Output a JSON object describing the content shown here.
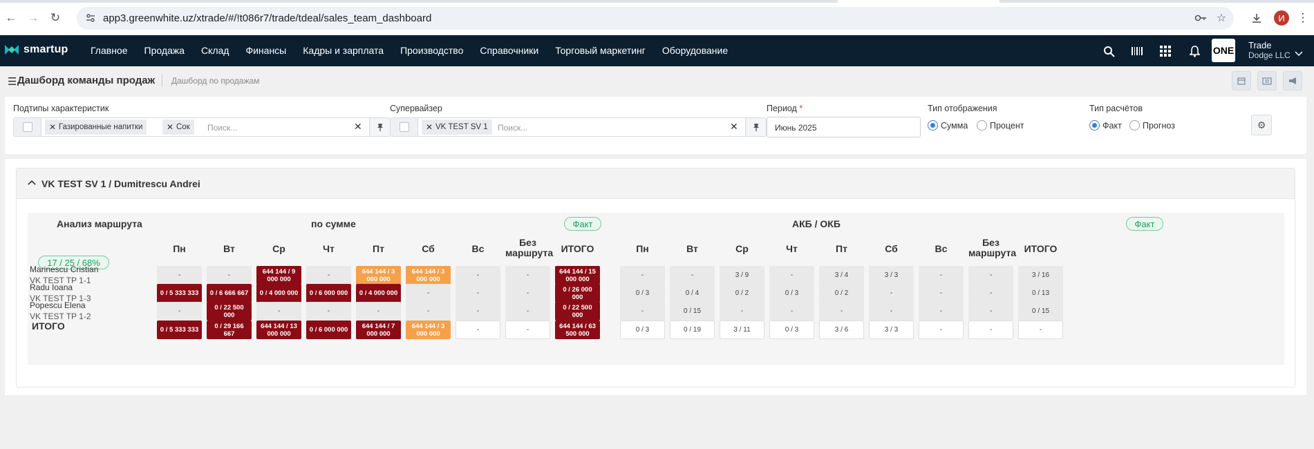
{
  "browser": {
    "url": "app3.greenwhite.uz/xtrade/#/!t086r7/trade/tdeal/sales_team_dashboard",
    "profile_initial": "И"
  },
  "app": {
    "logo_text": "smartup",
    "menu": [
      "Главное",
      "Продажа",
      "Склад",
      "Финансы",
      "Кадры и зарплата",
      "Производство",
      "Справочники",
      "Торговый маркетинг",
      "Оборудование"
    ],
    "brand_badge": "ONE",
    "company_line1": "Trade",
    "company_line2": "Dodge LLC"
  },
  "page": {
    "title": "Дашборд команды продаж",
    "breadcrumb": "Дашборд по продажам"
  },
  "filters": {
    "subtypes_label": "Подтипы характеристик",
    "subtypes_tags": [
      "Газированные напитки",
      "Сок"
    ],
    "search_placeholder": "Поиск...",
    "supervisor_label": "Супервайзер",
    "supervisor_tags": [
      "VK TEST SV 1"
    ],
    "period_label": "Период",
    "period_required_mark": "*",
    "period_value": "Июнь 2025",
    "display_type_label": "Тип отображения",
    "display_options": [
      "Сумма",
      "Процент"
    ],
    "display_selected": "Сумма",
    "calc_type_label": "Тип расчётов",
    "calc_options": [
      "Факт",
      "Прогноз"
    ],
    "calc_selected": "Факт"
  },
  "dashboard": {
    "group_title": "VK TEST SV 1 / Dumitrescu Andrei",
    "route_analysis_label": "Анализ маршрута",
    "by_sum_label": "по сумме",
    "fact_badge": "Факт",
    "akb_label": "АКБ / ОКБ",
    "summary_badge": "17 / 25 / 68%",
    "day_headers": [
      "Пн",
      "Вт",
      "Ср",
      "Чт",
      "Пт",
      "Сб",
      "Вс"
    ],
    "no_route_header": [
      "Без",
      "маршрута"
    ],
    "total_header": "ИТОГО",
    "total_row_label": "ИТОГО",
    "rows": [
      {
        "name": "Marinescu Cristian",
        "sub": "VK TEST TP 1-1",
        "sum": [
          {
            "v": "-",
            "c": "grey"
          },
          {
            "v": "-",
            "c": "grey"
          },
          {
            "v": "644 144 / 9 000 000",
            "c": "red"
          },
          {
            "v": "-",
            "c": "grey"
          },
          {
            "v": "644 144 / 3 000 000",
            "c": "orange"
          },
          {
            "v": "644 144 / 3 000 000",
            "c": "orange"
          },
          {
            "v": "-",
            "c": "grey"
          },
          {
            "v": "-",
            "c": "grey"
          },
          {
            "v": "644 144 / 15 000 000",
            "c": "red"
          }
        ],
        "akb": [
          "-",
          "-",
          "3 / 9",
          "-",
          "3 / 4",
          "3 / 3",
          "-",
          "-",
          "3 / 16"
        ]
      },
      {
        "name": "Radu Ioana",
        "sub": "VK TEST TP 1-3",
        "sum": [
          {
            "v": "0 / 5 333 333",
            "c": "red"
          },
          {
            "v": "0 / 6 666 667",
            "c": "red"
          },
          {
            "v": "0 / 4 000 000",
            "c": "red"
          },
          {
            "v": "0 / 6 000 000",
            "c": "red"
          },
          {
            "v": "0 / 4 000 000",
            "c": "red"
          },
          {
            "v": "-",
            "c": "grey"
          },
          {
            "v": "-",
            "c": "grey"
          },
          {
            "v": "-",
            "c": "grey"
          },
          {
            "v": "0 / 26 000 000",
            "c": "red"
          }
        ],
        "akb": [
          "0 / 3",
          "0 / 4",
          "0 / 2",
          "0 / 3",
          "0 / 2",
          "-",
          "-",
          "-",
          "0 / 13"
        ]
      },
      {
        "name": "Popescu Elena",
        "sub": "VK TEST TP 1-2",
        "sum": [
          {
            "v": "-",
            "c": "grey"
          },
          {
            "v": "0 / 22 500 000",
            "c": "red"
          },
          {
            "v": "-",
            "c": "grey"
          },
          {
            "v": "-",
            "c": "grey"
          },
          {
            "v": "-",
            "c": "grey"
          },
          {
            "v": "-",
            "c": "grey"
          },
          {
            "v": "-",
            "c": "grey"
          },
          {
            "v": "-",
            "c": "grey"
          },
          {
            "v": "0 / 22 500 000",
            "c": "red"
          }
        ],
        "akb": [
          "-",
          "0 / 15",
          "-",
          "-",
          "-",
          "-",
          "-",
          "-",
          "0 / 15"
        ]
      }
    ],
    "totals": {
      "sum": [
        {
          "v": "0 / 5 333 333",
          "c": "red"
        },
        {
          "v": "0 / 29 166 667",
          "c": "red"
        },
        {
          "v": "644 144 / 13 000 000",
          "c": "red"
        },
        {
          "v": "0 / 6 000 000",
          "c": "red"
        },
        {
          "v": "644 144 / 7 000 000",
          "c": "red"
        },
        {
          "v": "644 144 / 3 000 000",
          "c": "orange"
        },
        {
          "v": "-",
          "c": "white"
        },
        {
          "v": "-",
          "c": "white"
        },
        {
          "v": "644 144 / 63 500 000",
          "c": "red"
        }
      ],
      "akb": [
        "0 / 3",
        "0 / 19",
        "3 / 11",
        "0 / 3",
        "3 / 6",
        "3 / 3",
        "-",
        "-",
        "-"
      ]
    }
  }
}
